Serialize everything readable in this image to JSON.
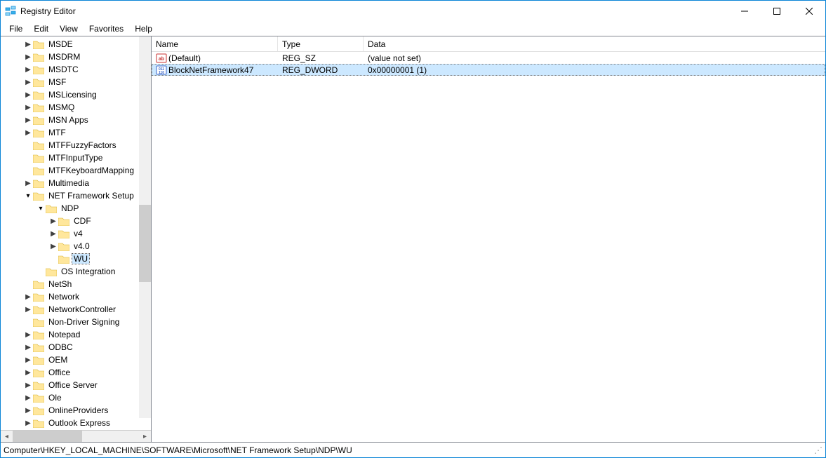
{
  "window": {
    "title": "Registry Editor"
  },
  "menu": {
    "file": "File",
    "edit": "Edit",
    "view": "View",
    "favorites": "Favorites",
    "help": "Help"
  },
  "tree": {
    "n0": "MSDE",
    "n1": "MSDRM",
    "n2": "MSDTC",
    "n3": "MSF",
    "n4": "MSLicensing",
    "n5": "MSMQ",
    "n6": "MSN Apps",
    "n7": "MTF",
    "n8": "MTFFuzzyFactors",
    "n9": "MTFInputType",
    "n10": "MTFKeyboardMapping",
    "n11": "Multimedia",
    "n12": "NET Framework Setup",
    "n13": "NDP",
    "n14": "CDF",
    "n15": "v4",
    "n16": "v4.0",
    "n17": "WU",
    "n18": "OS Integration",
    "n19": "NetSh",
    "n20": "Network",
    "n21": "NetworkController",
    "n22": "Non-Driver Signing",
    "n23": "Notepad",
    "n24": "ODBC",
    "n25": "OEM",
    "n26": "Office",
    "n27": "Office Server",
    "n28": "Ole",
    "n29": "OnlineProviders",
    "n30": "Outlook Express"
  },
  "list": {
    "headers": {
      "name": "Name",
      "type": "Type",
      "data": "Data"
    },
    "rows": [
      {
        "name": "(Default)",
        "type": "REG_SZ",
        "data": "(value not set)",
        "icon": "sz",
        "selected": false
      },
      {
        "name": "BlockNetFramework47",
        "type": "REG_DWORD",
        "data": "0x00000001 (1)",
        "icon": "dw",
        "selected": true
      }
    ]
  },
  "status": {
    "path": "Computer\\HKEY_LOCAL_MACHINE\\SOFTWARE\\Microsoft\\NET Framework Setup\\NDP\\WU"
  }
}
